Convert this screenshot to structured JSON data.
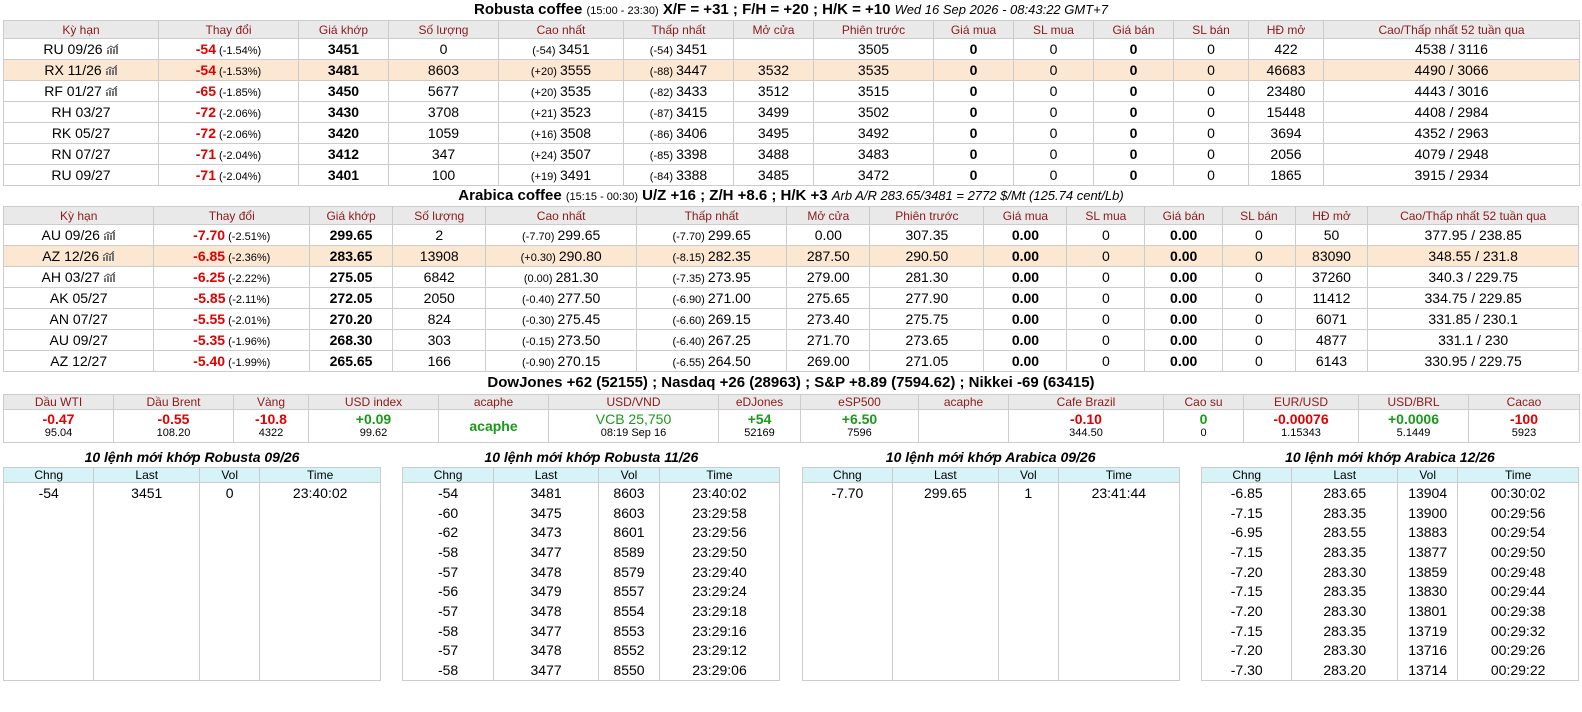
{
  "robusta": {
    "title": "Robusta coffee",
    "session": "(15:00 - 23:30)",
    "spreads": "X/F = +31 ; F/H = +20 ; H/K = +10",
    "datetime": "Wed 16 Sep 2026 - 08:43:22 GMT+7",
    "headers": [
      "Kỳ hạn",
      "Thay đổi",
      "Giá khớp",
      "Số lượng",
      "Cao nhất",
      "Thấp nhất",
      "Mở cửa",
      "Phiên trước",
      "Giá mua",
      "SL mua",
      "Giá bán",
      "SL bán",
      "HĐ mở",
      "Cao/Thấp nhất 52 tuần qua"
    ],
    "rows": [
      {
        "term": "RU 09/26",
        "chart": true,
        "chg": "-54",
        "pct": "(-1.54%)",
        "last": "3451",
        "vol": "0",
        "high_chg": "(-54)",
        "high": "3451",
        "low_chg": "(-54)",
        "low": "3451",
        "open": "",
        "prev": "3505",
        "bid": "0",
        "bid_vol": "0",
        "ask": "0",
        "ask_vol": "0",
        "oi": "422",
        "range52": "4538 / 3116",
        "highlight": false
      },
      {
        "term": "RX 11/26",
        "chart": true,
        "chg": "-54",
        "pct": "(-1.53%)",
        "last": "3481",
        "vol": "8603",
        "high_chg": "(+20)",
        "high": "3555",
        "low_chg": "(-88)",
        "low": "3447",
        "open": "3532",
        "prev": "3535",
        "bid": "0",
        "bid_vol": "0",
        "ask": "0",
        "ask_vol": "0",
        "oi": "46683",
        "range52": "4490 / 3066",
        "highlight": true
      },
      {
        "term": "RF 01/27",
        "chart": true,
        "chg": "-65",
        "pct": "(-1.85%)",
        "last": "3450",
        "vol": "5677",
        "high_chg": "(+20)",
        "high": "3535",
        "low_chg": "(-82)",
        "low": "3433",
        "open": "3512",
        "prev": "3515",
        "bid": "0",
        "bid_vol": "0",
        "ask": "0",
        "ask_vol": "0",
        "oi": "23480",
        "range52": "4443 / 3016",
        "highlight": false
      },
      {
        "term": "RH 03/27",
        "chart": false,
        "chg": "-72",
        "pct": "(-2.06%)",
        "last": "3430",
        "vol": "3708",
        "high_chg": "(+21)",
        "high": "3523",
        "low_chg": "(-87)",
        "low": "3415",
        "open": "3499",
        "prev": "3502",
        "bid": "0",
        "bid_vol": "0",
        "ask": "0",
        "ask_vol": "0",
        "oi": "15448",
        "range52": "4408 / 2984",
        "highlight": false
      },
      {
        "term": "RK 05/27",
        "chart": false,
        "chg": "-72",
        "pct": "(-2.06%)",
        "last": "3420",
        "vol": "1059",
        "high_chg": "(+16)",
        "high": "3508",
        "low_chg": "(-86)",
        "low": "3406",
        "open": "3495",
        "prev": "3492",
        "bid": "0",
        "bid_vol": "0",
        "ask": "0",
        "ask_vol": "0",
        "oi": "3694",
        "range52": "4352 / 2963",
        "highlight": false
      },
      {
        "term": "RN 07/27",
        "chart": false,
        "chg": "-71",
        "pct": "(-2.04%)",
        "last": "3412",
        "vol": "347",
        "high_chg": "(+24)",
        "high": "3507",
        "low_chg": "(-85)",
        "low": "3398",
        "open": "3488",
        "prev": "3483",
        "bid": "0",
        "bid_vol": "0",
        "ask": "0",
        "ask_vol": "0",
        "oi": "2056",
        "range52": "4079 / 2948",
        "highlight": false
      },
      {
        "term": "RU 09/27",
        "chart": false,
        "chg": "-71",
        "pct": "(-2.04%)",
        "last": "3401",
        "vol": "100",
        "high_chg": "(+19)",
        "high": "3491",
        "low_chg": "(-84)",
        "low": "3388",
        "open": "3485",
        "prev": "3472",
        "bid": "0",
        "bid_vol": "0",
        "ask": "0",
        "ask_vol": "0",
        "oi": "1865",
        "range52": "3915 / 2934",
        "highlight": false
      }
    ]
  },
  "arabica": {
    "title": "Arabica coffee",
    "session": "(15:15 - 00:30)",
    "spreads": "U/Z +16 ; Z/H +8.6 ; H/K +3",
    "arb": "Arb A/R 283.65/3481 = 2772 $/Mt (125.74 cent/Lb)",
    "headers": [
      "Kỳ hạn",
      "Thay đổi",
      "Giá khớp",
      "Số lượng",
      "Cao nhất",
      "Thấp nhất",
      "Mở cửa",
      "Phiên trước",
      "Giá mua",
      "SL mua",
      "Giá bán",
      "SL bán",
      "HĐ mở",
      "Cao/Thấp nhất 52 tuần qua"
    ],
    "rows": [
      {
        "term": "AU 09/26",
        "chart": true,
        "chg": "-7.70",
        "pct": "(-2.51%)",
        "last": "299.65",
        "vol": "2",
        "high_chg": "(-7.70)",
        "high": "299.65",
        "low_chg": "(-7.70)",
        "low": "299.65",
        "open": "0.00",
        "prev": "307.35",
        "bid": "0.00",
        "bid_vol": "0",
        "ask": "0.00",
        "ask_vol": "0",
        "oi": "50",
        "range52": "377.95 / 238.85",
        "highlight": false
      },
      {
        "term": "AZ 12/26",
        "chart": true,
        "chg": "-6.85",
        "pct": "(-2.36%)",
        "last": "283.65",
        "vol": "13908",
        "high_chg": "(+0.30)",
        "high": "290.80",
        "low_chg": "(-8.15)",
        "low": "282.35",
        "open": "287.50",
        "prev": "290.50",
        "bid": "0.00",
        "bid_vol": "0",
        "ask": "0.00",
        "ask_vol": "0",
        "oi": "83090",
        "range52": "348.55 / 231.8",
        "highlight": true
      },
      {
        "term": "AH 03/27",
        "chart": true,
        "chg": "-6.25",
        "pct": "(-2.22%)",
        "last": "275.05",
        "vol": "6842",
        "high_chg": "(0.00)",
        "high": "281.30",
        "low_chg": "(-7.35)",
        "low": "273.95",
        "open": "279.00",
        "prev": "281.30",
        "bid": "0.00",
        "bid_vol": "0",
        "ask": "0.00",
        "ask_vol": "0",
        "oi": "37260",
        "range52": "340.3 / 229.75",
        "highlight": false
      },
      {
        "term": "AK 05/27",
        "chart": false,
        "chg": "-5.85",
        "pct": "(-2.11%)",
        "last": "272.05",
        "vol": "2050",
        "high_chg": "(-0.40)",
        "high": "277.50",
        "low_chg": "(-6.90)",
        "low": "271.00",
        "open": "275.65",
        "prev": "277.90",
        "bid": "0.00",
        "bid_vol": "0",
        "ask": "0.00",
        "ask_vol": "0",
        "oi": "11412",
        "range52": "334.75 / 229.85",
        "highlight": false
      },
      {
        "term": "AN 07/27",
        "chart": false,
        "chg": "-5.55",
        "pct": "(-2.01%)",
        "last": "270.20",
        "vol": "824",
        "high_chg": "(-0.30)",
        "high": "275.45",
        "low_chg": "(-6.60)",
        "low": "269.15",
        "open": "273.40",
        "prev": "275.75",
        "bid": "0.00",
        "bid_vol": "0",
        "ask": "0.00",
        "ask_vol": "0",
        "oi": "6071",
        "range52": "331.85 / 230.1",
        "highlight": false
      },
      {
        "term": "AU 09/27",
        "chart": false,
        "chg": "-5.35",
        "pct": "(-1.96%)",
        "last": "268.30",
        "vol": "303",
        "high_chg": "(-0.15)",
        "high": "273.50",
        "low_chg": "(-6.40)",
        "low": "267.25",
        "open": "271.70",
        "prev": "273.65",
        "bid": "0.00",
        "bid_vol": "0",
        "ask": "0.00",
        "ask_vol": "0",
        "oi": "4877",
        "range52": "331.1 / 230",
        "highlight": false
      },
      {
        "term": "AZ 12/27",
        "chart": false,
        "chg": "-5.40",
        "pct": "(-1.99%)",
        "last": "265.65",
        "vol": "166",
        "high_chg": "(-0.90)",
        "high": "270.15",
        "low_chg": "(-6.55)",
        "low": "264.50",
        "open": "269.00",
        "prev": "271.05",
        "bid": "0.00",
        "bid_vol": "0",
        "ask": "0.00",
        "ask_vol": "0",
        "oi": "6143",
        "range52": "330.95 / 229.75",
        "highlight": false
      }
    ]
  },
  "indices_line": "DowJones +62 (52155) ; Nasdaq +26 (28963) ; S&P +8.89 (7594.62) ; Nikkei -69 (63415)",
  "markets": [
    {
      "label": "Dầu WTI",
      "value": "-0.47",
      "sub": "95.04",
      "tone": "red"
    },
    {
      "label": "Dầu Brent",
      "value": "-0.55",
      "sub": "108.20",
      "tone": "red"
    },
    {
      "label": "Vàng",
      "value": "-10.8",
      "sub": "4322",
      "tone": "red"
    },
    {
      "label": "USD index",
      "value": "+0.09",
      "sub": "99.62",
      "tone": "green"
    },
    {
      "label": "acaphe",
      "value": "acaphe",
      "sub": "",
      "tone": "green"
    },
    {
      "label": "USD/VND",
      "value": "VCB 25,750",
      "sub": "08:19 Sep 16",
      "tone": "greenplain"
    },
    {
      "label": "eDJones",
      "value": "+54",
      "sub": "52169",
      "tone": "green"
    },
    {
      "label": "eSP500",
      "value": "+6.50",
      "sub": "7596",
      "tone": "green"
    },
    {
      "label": "acaphe",
      "value": "",
      "sub": "",
      "tone": ""
    },
    {
      "label": "Cafe Brazil",
      "value": "-0.10",
      "sub": "344.50",
      "tone": "red"
    },
    {
      "label": "Cao su",
      "value": "0",
      "sub": "0",
      "tone": "green"
    },
    {
      "label": "EUR/USD",
      "value": "-0.00076",
      "sub": "1.15343",
      "tone": "red"
    },
    {
      "label": "USD/BRL",
      "value": "+0.0006",
      "sub": "5.1449",
      "tone": "green"
    },
    {
      "label": "Cacao",
      "value": "-100",
      "sub": "5923",
      "tone": "red"
    }
  ],
  "trades": [
    {
      "title": "10 lệnh mới khớp Robusta 09/26",
      "headers": [
        "Chng",
        "Last",
        "Vol",
        "Time"
      ],
      "rows": [
        [
          "-54",
          "3451",
          "0",
          "23:40:02"
        ]
      ]
    },
    {
      "title": "10 lệnh mới khớp Robusta 11/26",
      "headers": [
        "Chng",
        "Last",
        "Vol",
        "Time"
      ],
      "rows": [
        [
          "-54",
          "3481",
          "8603",
          "23:40:02"
        ],
        [
          "-60",
          "3475",
          "8603",
          "23:29:58"
        ],
        [
          "-62",
          "3473",
          "8601",
          "23:29:56"
        ],
        [
          "-58",
          "3477",
          "8589",
          "23:29:50"
        ],
        [
          "-57",
          "3478",
          "8579",
          "23:29:40"
        ],
        [
          "-56",
          "3479",
          "8557",
          "23:29:24"
        ],
        [
          "-57",
          "3478",
          "8554",
          "23:29:18"
        ],
        [
          "-58",
          "3477",
          "8553",
          "23:29:16"
        ],
        [
          "-57",
          "3478",
          "8552",
          "23:29:12"
        ],
        [
          "-58",
          "3477",
          "8550",
          "23:29:06"
        ]
      ]
    },
    {
      "title": "10 lệnh mới khớp Arabica 09/26",
      "headers": [
        "Chng",
        "Last",
        "Vol",
        "Time"
      ],
      "rows": [
        [
          "-7.70",
          "299.65",
          "1",
          "23:41:44"
        ]
      ]
    },
    {
      "title": "10 lệnh mới khớp Arabica 12/26",
      "headers": [
        "Chng",
        "Last",
        "Vol",
        "Time"
      ],
      "rows": [
        [
          "-6.85",
          "283.65",
          "13904",
          "00:30:02"
        ],
        [
          "-7.15",
          "283.35",
          "13900",
          "00:29:56"
        ],
        [
          "-6.95",
          "283.55",
          "13883",
          "00:29:54"
        ],
        [
          "-7.15",
          "283.35",
          "13877",
          "00:29:50"
        ],
        [
          "-7.20",
          "283.30",
          "13859",
          "00:29:48"
        ],
        [
          "-7.15",
          "283.35",
          "13830",
          "00:29:44"
        ],
        [
          "-7.20",
          "283.30",
          "13801",
          "00:29:38"
        ],
        [
          "-7.15",
          "283.35",
          "13719",
          "00:29:32"
        ],
        [
          "-7.20",
          "283.30",
          "13716",
          "00:29:26"
        ],
        [
          "-7.30",
          "283.20",
          "13714",
          "00:29:22"
        ]
      ]
    }
  ],
  "colors": {
    "negative": "#e00000",
    "positive": "#1a9a1a",
    "highlight_row": "#fce8d2",
    "header_text": "#8b1a1a"
  }
}
